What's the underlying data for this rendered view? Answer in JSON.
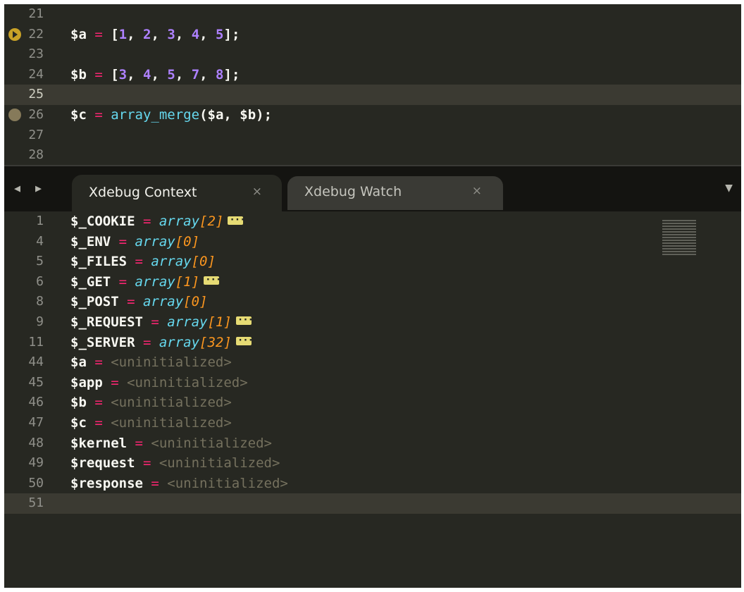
{
  "editor": {
    "lines": [
      {
        "num": "21",
        "code": []
      },
      {
        "num": "22",
        "breakpoint": "active",
        "code": [
          {
            "t": "$a ",
            "c": ""
          },
          {
            "t": "= ",
            "c": "op"
          },
          {
            "t": "[",
            "c": ""
          },
          {
            "t": "1",
            "c": "num"
          },
          {
            "t": ", ",
            "c": ""
          },
          {
            "t": "2",
            "c": "num"
          },
          {
            "t": ", ",
            "c": ""
          },
          {
            "t": "3",
            "c": "num"
          },
          {
            "t": ", ",
            "c": ""
          },
          {
            "t": "4",
            "c": "num"
          },
          {
            "t": ", ",
            "c": ""
          },
          {
            "t": "5",
            "c": "num"
          },
          {
            "t": "];",
            "c": ""
          }
        ]
      },
      {
        "num": "23",
        "code": []
      },
      {
        "num": "24",
        "code": [
          {
            "t": "$b ",
            "c": ""
          },
          {
            "t": "= ",
            "c": "op"
          },
          {
            "t": "[",
            "c": ""
          },
          {
            "t": "3",
            "c": "num"
          },
          {
            "t": ", ",
            "c": ""
          },
          {
            "t": "4",
            "c": "num"
          },
          {
            "t": ", ",
            "c": ""
          },
          {
            "t": "5",
            "c": "num"
          },
          {
            "t": ", ",
            "c": ""
          },
          {
            "t": "7",
            "c": "num"
          },
          {
            "t": ", ",
            "c": ""
          },
          {
            "t": "8",
            "c": "num"
          },
          {
            "t": "];",
            "c": ""
          }
        ]
      },
      {
        "num": "25",
        "current": true,
        "code": []
      },
      {
        "num": "26",
        "breakpoint": "inactive",
        "code": [
          {
            "t": "$c ",
            "c": ""
          },
          {
            "t": "= ",
            "c": "op"
          },
          {
            "t": "array_merge",
            "c": "fn"
          },
          {
            "t": "($a, $b);",
            "c": ""
          }
        ]
      },
      {
        "num": "27",
        "code": []
      },
      {
        "num": "28",
        "code": []
      }
    ]
  },
  "tabs": {
    "nav_arrows": "◀ ▶",
    "menu_arrow": "▼",
    "close_glyph": "×",
    "items": [
      {
        "label": "Xdebug Context",
        "active": true
      },
      {
        "label": "Xdebug Watch",
        "active": false
      }
    ]
  },
  "context": {
    "rows": [
      {
        "num": "1",
        "var": "$_COOKIE",
        "type": "array",
        "count": "[2]",
        "expand": true
      },
      {
        "num": "4",
        "var": "$_ENV",
        "type": "array",
        "count": "[0]"
      },
      {
        "num": "5",
        "var": "$_FILES",
        "type": "array",
        "count": "[0]"
      },
      {
        "num": "6",
        "var": "$_GET",
        "type": "array",
        "count": "[1]",
        "expand": true
      },
      {
        "num": "8",
        "var": "$_POST",
        "type": "array",
        "count": "[0]"
      },
      {
        "num": "9",
        "var": "$_REQUEST",
        "type": "array",
        "count": "[1]",
        "expand": true
      },
      {
        "num": "11",
        "var": "$_SERVER",
        "type": "array",
        "count": "[32]",
        "expand": true
      },
      {
        "num": "44",
        "var": "$a",
        "value": "<uninitialized>"
      },
      {
        "num": "45",
        "var": "$app",
        "value": "<uninitialized>"
      },
      {
        "num": "46",
        "var": "$b",
        "value": "<uninitialized>"
      },
      {
        "num": "47",
        "var": "$c",
        "value": "<uninitialized>"
      },
      {
        "num": "48",
        "var": "$kernel",
        "value": "<uninitialized>"
      },
      {
        "num": "49",
        "var": "$request",
        "value": "<uninitialized>"
      },
      {
        "num": "50",
        "var": "$response",
        "value": "<uninitialized>"
      },
      {
        "num": "51",
        "current": true
      }
    ]
  },
  "colors": {
    "background": "#272822",
    "operator": "#f92672",
    "number": "#ae81ff",
    "function": "#66d9ef",
    "type": "#66d9ef",
    "count": "#fd971f",
    "uninitialized": "#75715e",
    "expand_badge": "#e6db74",
    "breakpoint_active": "#c9a227"
  }
}
